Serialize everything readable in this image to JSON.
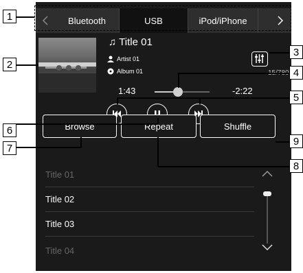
{
  "tabs": [
    {
      "label": "Bluetooth",
      "active": false
    },
    {
      "label": "USB",
      "active": true
    },
    {
      "label": "iPod/iPhone",
      "active": false
    }
  ],
  "track": {
    "title": "Title 01",
    "artist": "Artist 01",
    "album": "Album 01",
    "counter": "15/780",
    "elapsed": "1:43",
    "remaining": "-2:22",
    "progress": 0.43
  },
  "buttons": {
    "browse": "Browse",
    "repeat": "Repeat",
    "shuffle": "Shuffle"
  },
  "playlist": [
    {
      "label": "Title 01",
      "dim": true
    },
    {
      "label": "Title 02",
      "dim": false
    },
    {
      "label": "Title 03",
      "dim": false
    },
    {
      "label": "Title 04",
      "dim": true
    }
  ],
  "callouts": [
    "1",
    "2",
    "3",
    "4",
    "5",
    "6",
    "7",
    "8",
    "9"
  ]
}
